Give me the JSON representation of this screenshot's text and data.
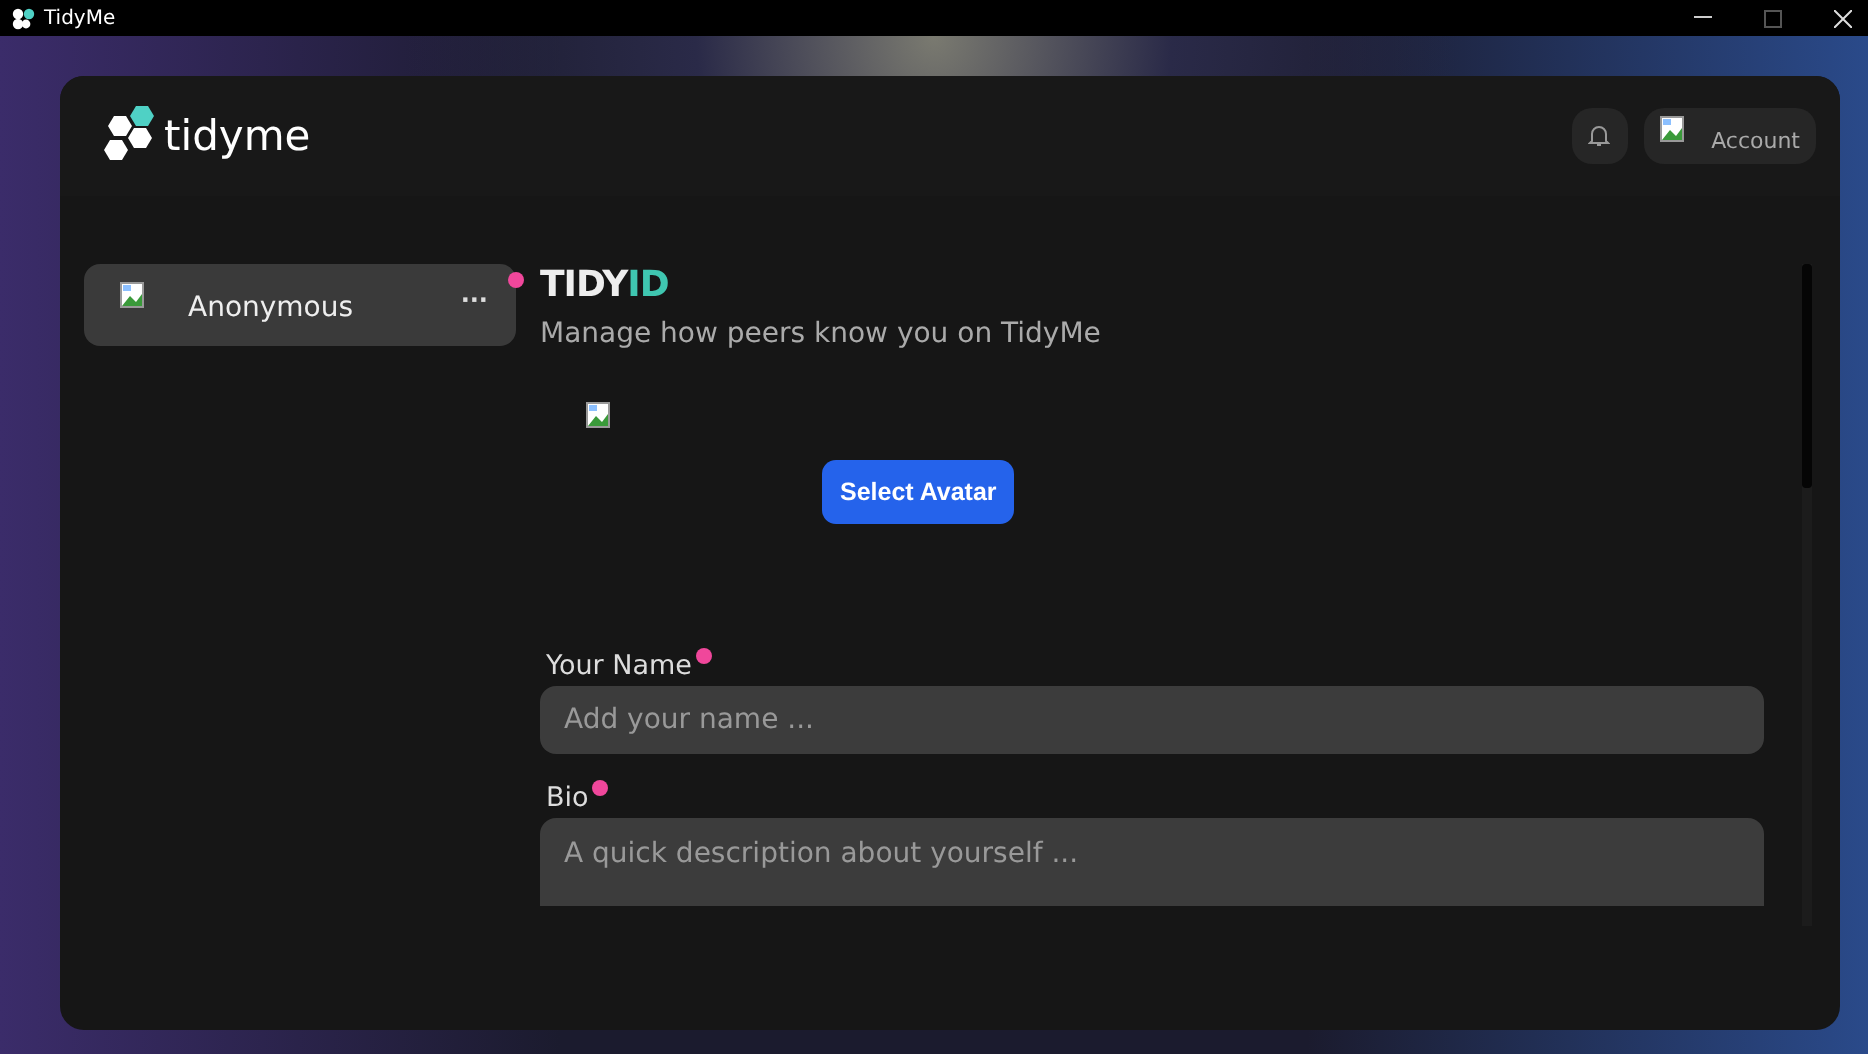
{
  "window": {
    "title": "TidyMe"
  },
  "header": {
    "logo_text": "tidyme",
    "account_label": "Account"
  },
  "sidebar": {
    "items": [
      {
        "label": "Anonymous",
        "menu": "···",
        "selected": true,
        "marked": true
      }
    ]
  },
  "main": {
    "title_main": "TIDY",
    "title_accent": "ID",
    "subtitle": "Manage how peers know you on TidyMe",
    "avatar_button": "Select Avatar",
    "fields": [
      {
        "label": "Your Name",
        "placeholder": "Add your name ...",
        "required": true,
        "kind": "line"
      },
      {
        "label": "Bio",
        "placeholder": "A quick description about yourself ...",
        "required": true,
        "kind": "area"
      }
    ]
  }
}
